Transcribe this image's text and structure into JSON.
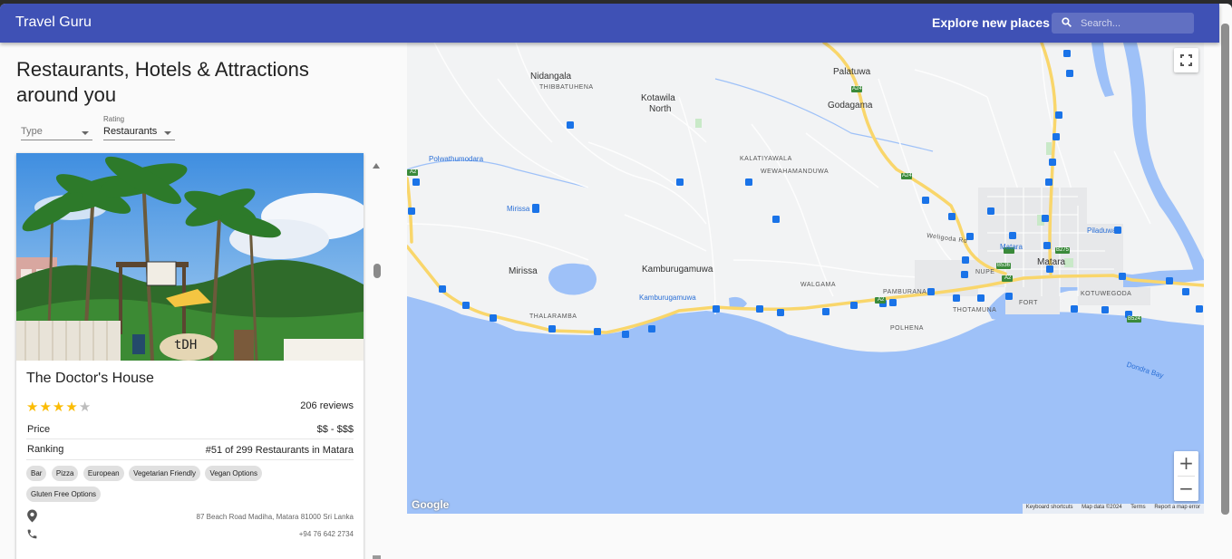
{
  "appbar": {
    "title": "Travel Guru",
    "explore_label": "Explore new places",
    "search_placeholder": "Search..."
  },
  "page": {
    "heading": "Restaurants, Hotels & Attractions around you"
  },
  "filters": {
    "type": {
      "label": "",
      "value": "Type"
    },
    "rating": {
      "label": "Rating",
      "value": "Restaurants"
    }
  },
  "place": {
    "name": "The Doctor's House",
    "rating": 4,
    "rating_max": 5,
    "reviews": "206 reviews",
    "price_label": "Price",
    "price_value": "$$ - $$$",
    "ranking_label": "Ranking",
    "ranking_value": "#51 of 299 Restaurants in Matara",
    "tags": [
      "Bar",
      "Pizza",
      "European",
      "Vegetarian Friendly",
      "Vegan Options",
      "Gluten Free Options"
    ],
    "address": "87 Beach Road Madiha, Matara 81000 Sri Lanka",
    "phone": "+94 76 642 2734",
    "photo_sign": "tDH"
  },
  "map": {
    "labels": {
      "nidangala": "Nidangala",
      "thibbatuhena": "THIBBATUHENA",
      "kotawila": "Kotawila",
      "north": "North",
      "palatuwa": "Palatuwa",
      "godagama": "Godagama",
      "polwathumodara": "Polwathumodara",
      "kalatiyawala": "KALATIYAWALA",
      "wewahamanduwa": "WEWAHAMANDUWA",
      "mirissa_stop": "Mirissa",
      "mirissa": "Mirissa",
      "kamburugamuwa": "Kamburugamuwa",
      "kamburugamuwa_stop": "Kamburugamuwa",
      "walgama": "WALGAMA",
      "thalaramba": "THALARAMBA",
      "pamburana": "PAMBURANA",
      "polhena": "POLHENA",
      "thotamuna": "THOTAMUNA",
      "nupe": "NUPE",
      "fort": "FORT",
      "kotuwegoda": "KOTUWEGODA",
      "matara": "Matara",
      "matara_stop": "Matara",
      "piladuwa": "Piladuwa",
      "weligoda_rd": "Weligoda Rd",
      "dondra_bay": "Dondra Bay",
      "a24_1": "A24",
      "a24_2": "A24",
      "a2_1": "A2",
      "a2_2": "A2",
      "a2_3": "A2",
      "b275": "B275",
      "b536": "B536",
      "b524": "B524"
    },
    "google": "Google",
    "attribution": {
      "shortcuts": "Keyboard shortcuts",
      "mapdata": "Map data ©2024",
      "terms": "Terms",
      "report": "Report a map error"
    },
    "zoom_in": "+",
    "zoom_out": "−"
  },
  "colors": {
    "appbar": "#3f51b5",
    "water": "#9ec1f8",
    "star": "#fbbc04",
    "road": "#f9d66b",
    "transit": "#1a73e8"
  }
}
